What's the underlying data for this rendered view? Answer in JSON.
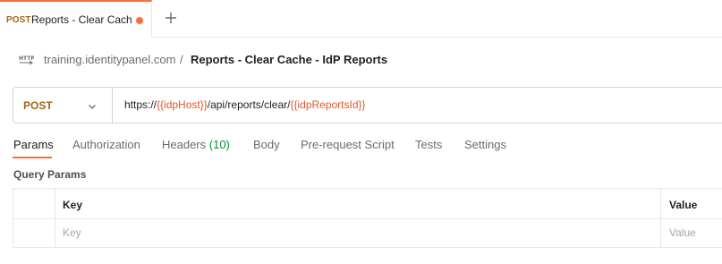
{
  "tab": {
    "method": "POST",
    "title": "Reports - Clear Cache - IdP Reports",
    "accent_color": "#ff6c37",
    "unsaved_indicator": "dot-icon",
    "new_tab_icon": "plus-icon"
  },
  "breadcrumb": {
    "icon": "http-icon",
    "parent": "training.identitypanel.com",
    "separator": "/",
    "title": "Reports - Clear Cache - IdP Reports"
  },
  "request": {
    "method": "POST",
    "method_color": "#a0661a",
    "chevron_icon": "chevron-down-icon",
    "url_parts": [
      {
        "text": "https://",
        "var": false
      },
      {
        "text": "{{idpHost}}",
        "var": true
      },
      {
        "text": "/api/reports/clear/",
        "var": false
      },
      {
        "text": "{{idpReportsId}}",
        "var": true
      }
    ],
    "variable_color": "#e5562a"
  },
  "request_tabs": [
    {
      "label": "Params",
      "active": true
    },
    {
      "label": "Authorization",
      "active": false
    },
    {
      "label": "Headers",
      "count": "(10)",
      "active": false
    },
    {
      "label": "Body",
      "active": false
    },
    {
      "label": "Pre-request Script",
      "active": false
    },
    {
      "label": "Tests",
      "active": false
    },
    {
      "label": "Settings",
      "active": false
    }
  ],
  "query_params": {
    "title": "Query Params",
    "columns": [
      "Key",
      "Value"
    ],
    "placeholder_row": {
      "key": "Key",
      "value": "Value"
    }
  }
}
